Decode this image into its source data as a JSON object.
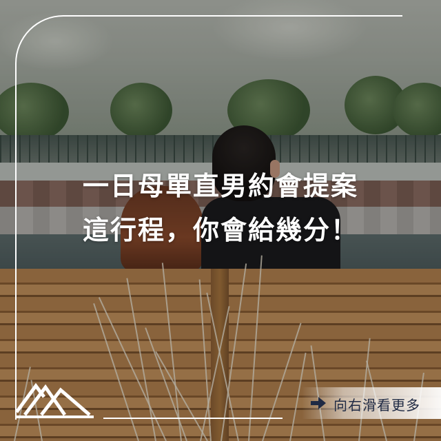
{
  "headline": {
    "line1": "一日母單直男約會提案",
    "line2": "這行程，你會給幾分！"
  },
  "swipe_hint": {
    "label": "向右滑看更多",
    "icon": "right-arrow-icon"
  },
  "logo": {
    "icon": "mountain-logo-icon"
  },
  "colors": {
    "text": "#ffffff",
    "swipe_text": "#1f2a44",
    "frame": "#ffffff"
  }
}
